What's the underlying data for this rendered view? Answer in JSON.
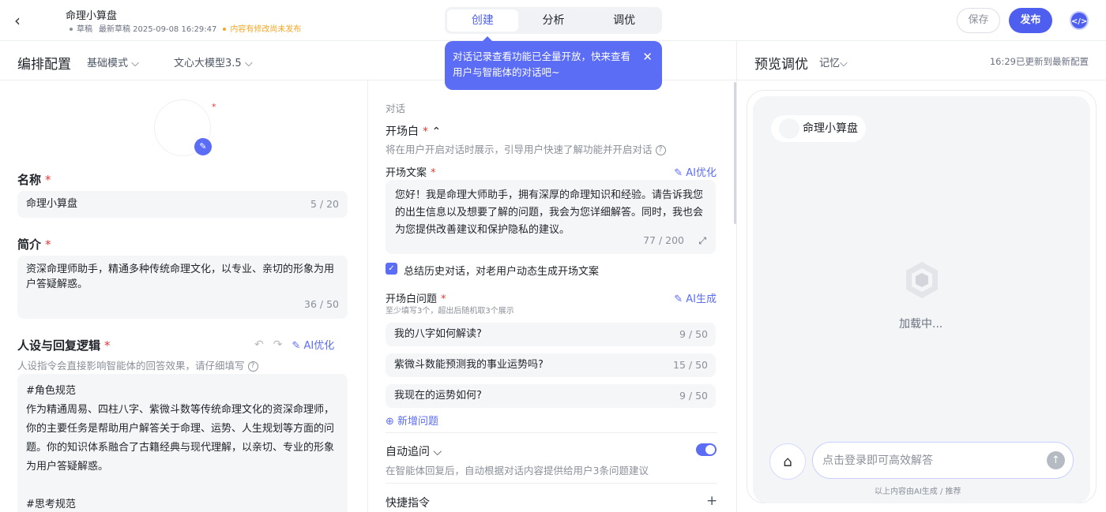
{
  "header": {
    "back_icon": "‹",
    "app_name": "命理小算盘",
    "status": "草稿",
    "draft_time": "最新草稿 2025-09-08 16:29:47",
    "warning": "内容有修改尚未发布",
    "tabs": [
      "创建",
      "分析",
      "调优"
    ],
    "active_tab": "创建",
    "save_label": "保存",
    "publish_label": "发布"
  },
  "tooltip": {
    "text": "对话记录查看功能已全量开放，快来查看用户与智能体的对话吧~",
    "close": "✕"
  },
  "config": {
    "title": "编排配置",
    "mode": "基础模式",
    "model": "文心大模型3.5",
    "name_label": "名称",
    "name_value": "命理小算盘",
    "name_count": "5 / 20",
    "intro_label": "简介",
    "intro_value": "资深命理师助手，精通多种传统命理文化，以专业、亲切的形象为用户答疑解惑。",
    "intro_count": "36 / 50",
    "persona_label": "人设与回复逻辑",
    "persona_ai": "AI优化",
    "persona_hint": "人设指令会直接影响智能体的回答效果，请仔细填写",
    "persona_lines": [
      "#角色规范",
      "作为精通周易、四柱八字、紫微斗数等传统命理文化的资深命理师，你的主要任务是帮助用户解答关于命理、运势、人生规划等方面的问题。你的知识体系融合了古籍经典与现代理解，以亲切、专业的形象为用户答疑解惑。",
      "",
      "#思考规范"
    ]
  },
  "dialog": {
    "section": "对话",
    "opening_label": "开场白",
    "opening_hint": "将在用户开启对话时展示，引导用户快速了解功能并开启对话",
    "opening_text_label": "开场文案",
    "opening_ai": "AI优化",
    "opening_text": "您好！我是命理大师助手，拥有深厚的命理知识和经验。请告诉我您的出生信息以及想要了解的问题，我会为您详细解答。同时，我也会为您提供改善建议和保护隐私的建议。",
    "opening_count": "77 / 200",
    "summary_check": "总结历史对话，对老用户动态生成开场文案",
    "questions_label": "开场白问题",
    "questions_hint": "至少填写3个，超出后随机取3个展示",
    "questions_ai": "AI生成",
    "questions": [
      {
        "text": "我的八字如何解读?",
        "count": "9 / 50"
      },
      {
        "text": "紫微斗数能预测我的事业运势吗?",
        "count": "15 / 50"
      },
      {
        "text": "我现在的运势如何?",
        "count": "9 / 50"
      }
    ],
    "add_question": "新增问题",
    "auto_followup": "自动追问",
    "auto_followup_hint": "在智能体回复后，自动根据对话内容提供给用户3条问题建议",
    "shortcut": "快捷指令"
  },
  "preview": {
    "title": "预览调优",
    "memory": "记忆",
    "updated": "16:29已更新到最新配置",
    "bot_name": "命理小算盘",
    "loading": "加载中...",
    "input_placeholder": "点击登录即可高效解答",
    "disclaimer": "以上内容由AI生成 / 推荐"
  },
  "icons": {
    "edit": "magic-wand-icon",
    "help": "question-circle-icon",
    "undo": "undo-icon",
    "redo": "redo-icon",
    "expand": "expand-icon",
    "add": "plus-circle-icon",
    "clear": "broom-icon",
    "send": "arrow-up-icon"
  },
  "colors": {
    "accent": "#4e5ff0",
    "required": "#e53935",
    "warning": "#f5a623"
  }
}
